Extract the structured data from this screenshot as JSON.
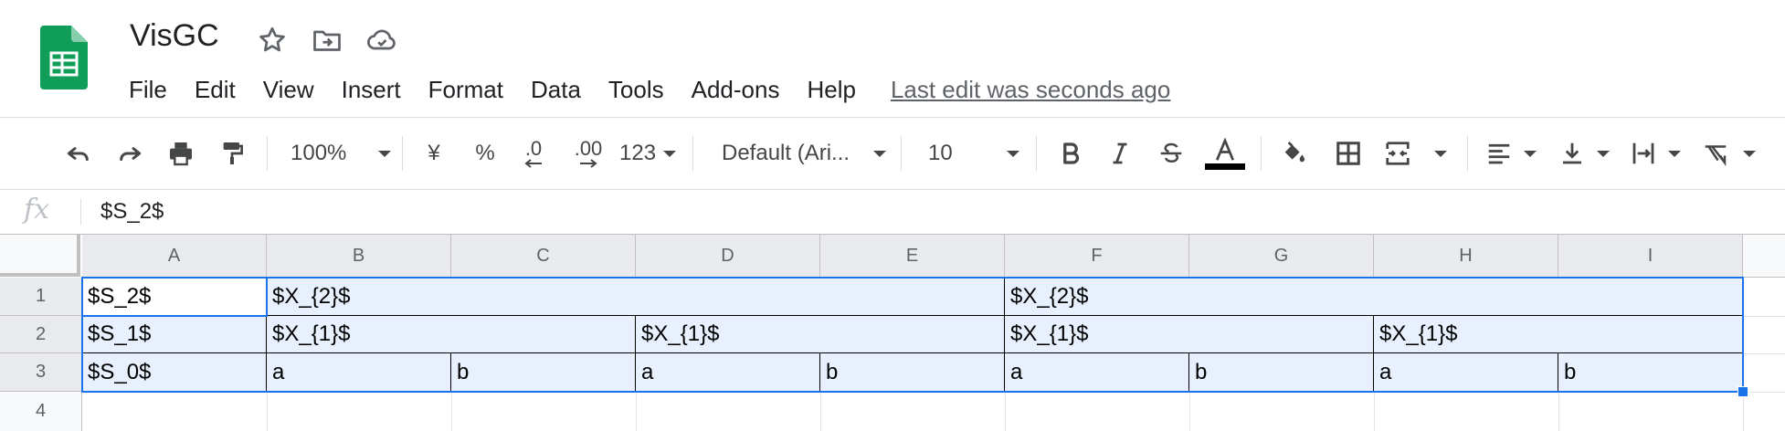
{
  "app": {
    "title": "VisGC",
    "brand_color": "#0f9d58",
    "title_icons": [
      "star-icon",
      "move-to-folder-icon",
      "cloud-saved-icon"
    ]
  },
  "menu": {
    "items": [
      "File",
      "Edit",
      "View",
      "Insert",
      "Format",
      "Data",
      "Tools",
      "Add-ons",
      "Help"
    ],
    "last_edit": "Last edit was seconds ago"
  },
  "toolbar": {
    "zoom": "100%",
    "currency": "¥",
    "percent": "%",
    "decrease_decimal": ".0",
    "increase_decimal": ".00",
    "more_formats": "123",
    "font": "Default (Ari...",
    "font_size": "10",
    "icons": [
      "undo-icon",
      "redo-icon",
      "print-icon",
      "paint-format-icon",
      "bold-icon",
      "italic-icon",
      "strikethrough-icon",
      "text-color-icon",
      "fill-color-icon",
      "borders-icon",
      "merge-cells-icon",
      "horizontal-align-icon",
      "vertical-align-icon",
      "text-wrap-icon",
      "text-rotation-icon"
    ]
  },
  "formula_bar": {
    "fx": "fx",
    "value": "$S_2$"
  },
  "sheet": {
    "columns": [
      "A",
      "B",
      "C",
      "D",
      "E",
      "F",
      "G",
      "H",
      "I"
    ],
    "rows": [
      "1",
      "2",
      "3",
      "4"
    ],
    "row1": [
      "$S_2$",
      "$X_{2}$",
      "$X_{2}$"
    ],
    "row2": [
      "$S_1$",
      "$X_{1}$",
      "$X_{1}$",
      "$X_{1}$",
      "$X_{1}$"
    ],
    "row3": [
      "$S_0$",
      "a",
      "b",
      "a",
      "b",
      "a",
      "b",
      "a",
      "b"
    ],
    "selection_color": "#1a73e8"
  }
}
